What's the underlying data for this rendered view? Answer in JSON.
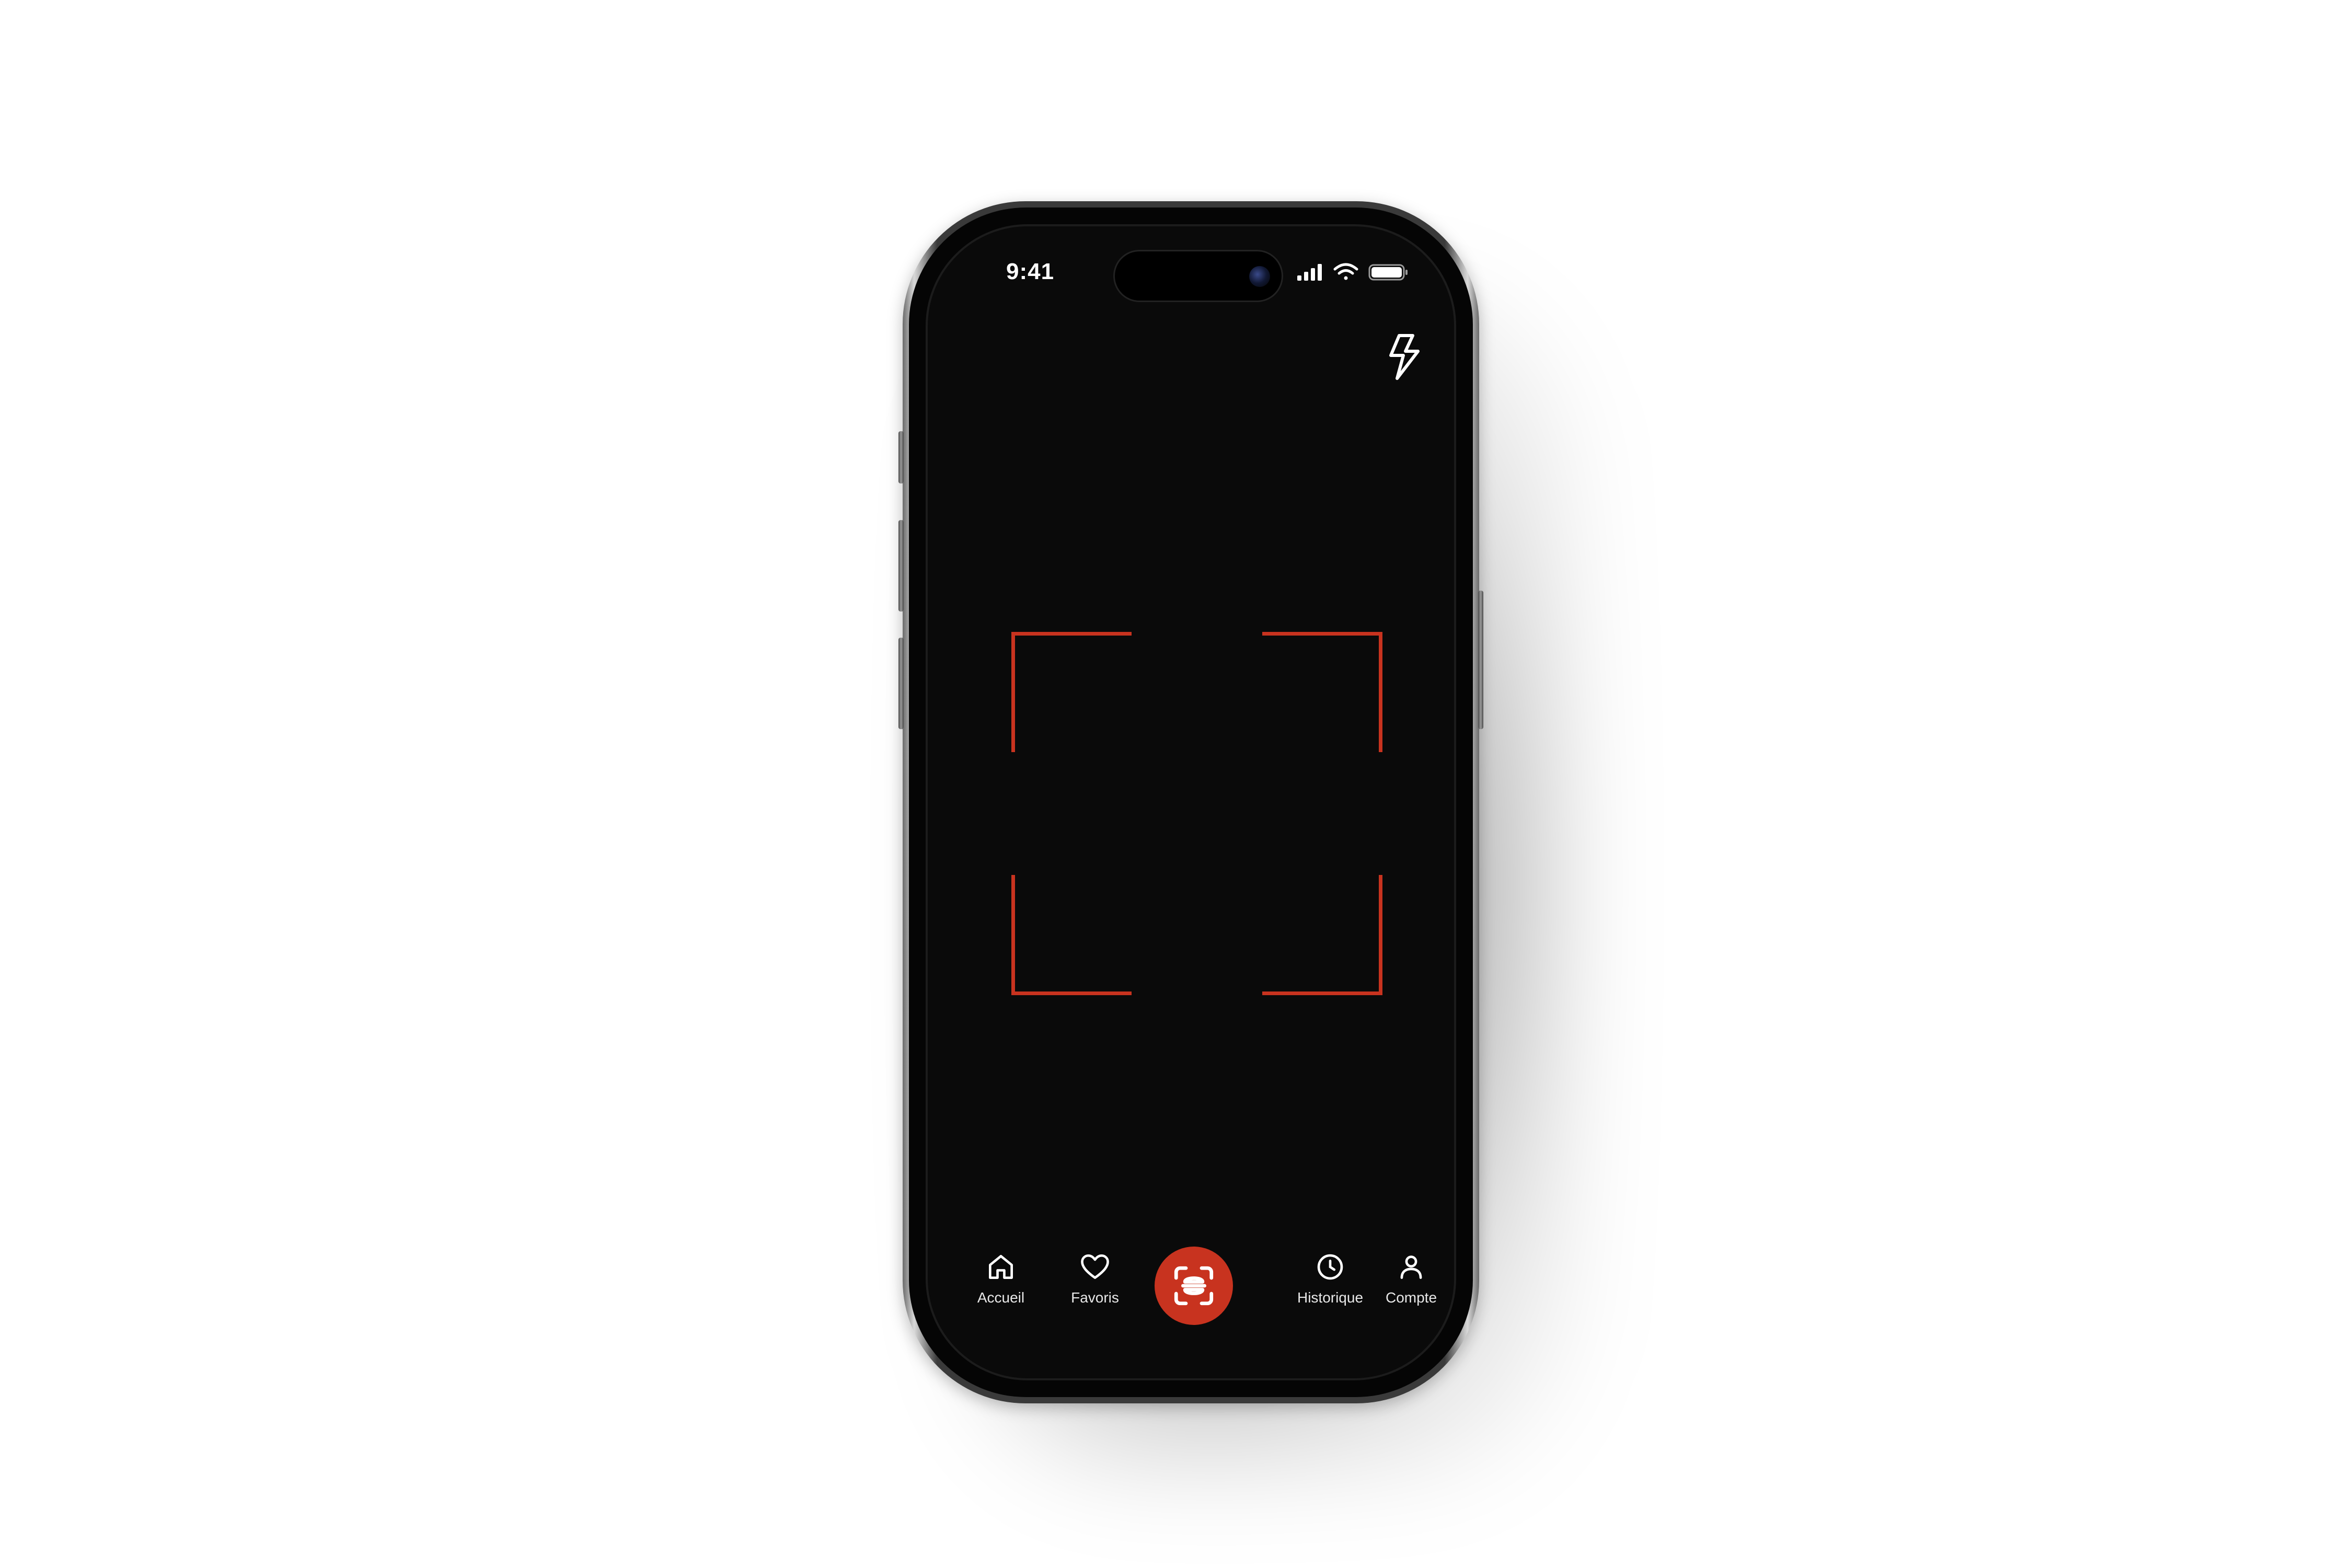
{
  "status_bar": {
    "time": "9:41"
  },
  "camera": {
    "flash_icon": "flash-icon",
    "frame_color": "#c8331f"
  },
  "tab_bar": {
    "items": [
      {
        "label": "Accueil",
        "icon": "home-icon"
      },
      {
        "label": "Favoris",
        "icon": "heart-icon"
      },
      {
        "label": "",
        "icon": "scan-icon"
      },
      {
        "label": "Historique",
        "icon": "clock-icon"
      },
      {
        "label": "Compte",
        "icon": "user-icon"
      }
    ],
    "accent_color": "#c8331f"
  }
}
